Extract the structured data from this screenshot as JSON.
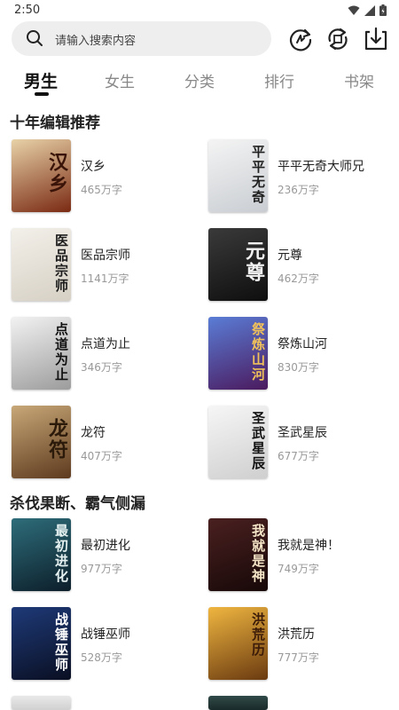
{
  "status": {
    "time": "2:50"
  },
  "search": {
    "placeholder": "请输入搜索内容"
  },
  "tabs": [
    "男生",
    "女生",
    "分类",
    "排行",
    "书架"
  ],
  "sections": [
    {
      "title": "十年编辑推荐",
      "books": [
        {
          "name": "汉乡",
          "count": "465万字",
          "cover_text": "汉乡",
          "colors": [
            "#e8d2a8",
            "#7a2a12"
          ],
          "ink": "#3a1408"
        },
        {
          "name": "平平无奇大师兄",
          "count": "236万字",
          "cover_text": "平平无奇",
          "colors": [
            "#f4f4f4",
            "#c9cdd2"
          ],
          "ink": "#202020"
        },
        {
          "name": "医品宗师",
          "count": "1141万字",
          "cover_text": "医品宗师",
          "colors": [
            "#f3f0ea",
            "#d6d0c4"
          ],
          "ink": "#1d1d1d"
        },
        {
          "name": "元尊",
          "count": "462万字",
          "cover_text": "元尊",
          "colors": [
            "#3a3a3a",
            "#0e0e0e"
          ],
          "ink": "#f1f1f1"
        },
        {
          "name": "点道为止",
          "count": "346万字",
          "cover_text": "点道为止",
          "colors": [
            "#f2f2f2",
            "#9c9c9c"
          ],
          "ink": "#111111"
        },
        {
          "name": "祭炼山河",
          "count": "830万字",
          "cover_text": "祭炼山河",
          "colors": [
            "#5a7dd6",
            "#4b1a5e"
          ],
          "ink": "#f0c05a"
        },
        {
          "name": "龙符",
          "count": "407万字",
          "cover_text": "龙符",
          "colors": [
            "#c8a878",
            "#5d3a1e"
          ],
          "ink": "#2b1a0a"
        },
        {
          "name": "圣武星辰",
          "count": "677万字",
          "cover_text": "圣武星辰",
          "colors": [
            "#f6f6f6",
            "#cfcfcf"
          ],
          "ink": "#111111"
        }
      ]
    },
    {
      "title": "杀伐果断、霸气侧漏",
      "books": [
        {
          "name": "最初进化",
          "count": "977万字",
          "cover_text": "最初进化",
          "colors": [
            "#2e6d7a",
            "#0c1e2a"
          ],
          "ink": "#e6f2f2"
        },
        {
          "name": "我就是神！",
          "count": "749万字",
          "cover_text": "我就是神",
          "colors": [
            "#4a2020",
            "#170808"
          ],
          "ink": "#f5e6c8"
        },
        {
          "name": "战锤巫师",
          "count": "528万字",
          "cover_text": "战锤巫师",
          "colors": [
            "#1e3a78",
            "#0a0f22"
          ],
          "ink": "#ffffff"
        },
        {
          "name": "洪荒历",
          "count": "777万字",
          "cover_text": "洪荒历",
          "colors": [
            "#f0b640",
            "#6a3a10"
          ],
          "ink": "#3a1a08"
        }
      ]
    }
  ]
}
